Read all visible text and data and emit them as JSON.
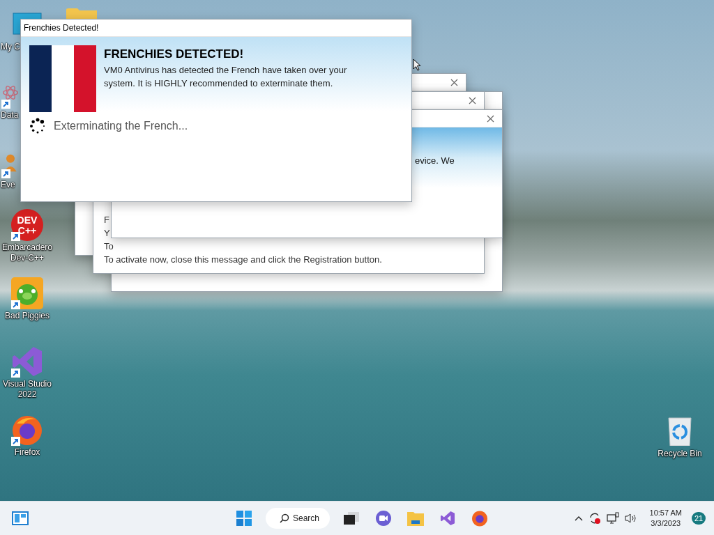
{
  "desktop_icons": [
    {
      "kind": "monitor",
      "label": "My C",
      "shortcut": false
    },
    {
      "kind": "folder",
      "shortcut": false
    },
    {
      "kind": "atom",
      "label": "Data",
      "shortcut": true
    },
    {
      "kind": "person",
      "label": "Eve",
      "shortcut": true
    },
    {
      "kind": "devcpp",
      "label": "Embarcadero Dev-C++",
      "logo_text": "DEV C++",
      "shortcut": true
    },
    {
      "kind": "pig",
      "label": "Bad Piggies",
      "shortcut": true
    },
    {
      "kind": "vs",
      "label": "Visual Studio 2022",
      "shortcut": true
    },
    {
      "kind": "firefox",
      "label": "Firefox",
      "shortcut": true
    },
    {
      "kind": "recycle",
      "label": "Recycle Bin",
      "shortcut": false
    }
  ],
  "background_windows": [
    {
      "kind": "plain",
      "close_button": true
    },
    {
      "kind": "plain",
      "close_button": false
    },
    {
      "kind": "message",
      "close_button": true,
      "lines": [
        "F",
        "Y",
        "To",
        "To activate now, close this message and click the Registration button."
      ]
    },
    {
      "kind": "banner",
      "close_button": true,
      "text": "evice. We"
    }
  ],
  "front_window": {
    "title": "Frenchies Detected!",
    "heading": "FRENCHIES DETECTED!",
    "message": "VM0 Antivirus has detected the French have taken over your system. It is HIGHLY recommended to exterminate them.",
    "status": "Exterminating the French..."
  },
  "taskbar": {
    "apps": [
      {
        "kind": "start"
      },
      {
        "kind": "search",
        "label": "Search"
      },
      {
        "kind": "taskview"
      },
      {
        "kind": "chat"
      },
      {
        "kind": "explorer"
      },
      {
        "kind": "vs"
      },
      {
        "kind": "firefox"
      }
    ],
    "tray": {
      "time": "10:57 AM",
      "date": "3/3/2023",
      "notifications": "21"
    }
  }
}
